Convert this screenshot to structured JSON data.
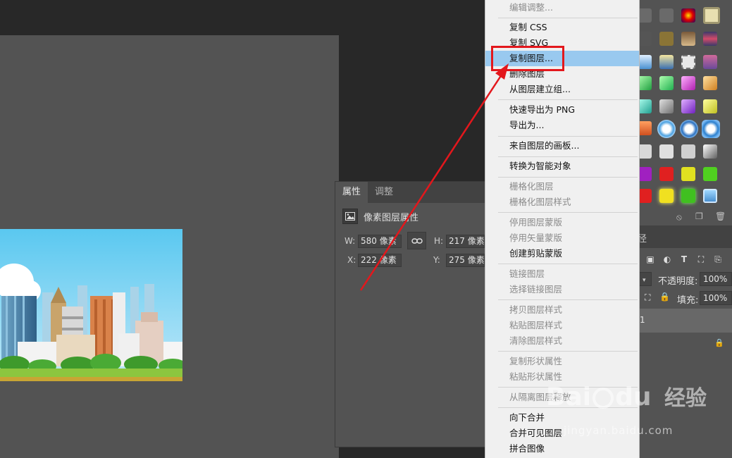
{
  "properties_panel": {
    "tabs": [
      "属性",
      "调整"
    ],
    "header": "像素图层属性",
    "w_label": "W:",
    "w_value": "580 像素",
    "h_label": "H:",
    "h_value": "217 像素",
    "x_label": "X:",
    "x_value": "222 像素",
    "y_label": "Y:",
    "y_value": "275 像素"
  },
  "layers_panel": {
    "tab_label": "径",
    "opacity_label": "不透明度:",
    "opacity_value": "100%",
    "fill_label": "填充:",
    "fill_value": "100%",
    "layer_name": "1"
  },
  "context_menu": {
    "items": [
      {
        "label": "编辑调整...",
        "disabled": true
      },
      {
        "label": "复制 CSS",
        "disabled": false
      },
      {
        "label": "复制 SVG",
        "disabled": false
      },
      {
        "label": "复制图层...",
        "disabled": false,
        "highlighted": true
      },
      {
        "label": "删除图层",
        "disabled": false
      },
      {
        "label": "从图层建立组...",
        "disabled": false
      },
      {
        "label": "快速导出为 PNG",
        "disabled": false
      },
      {
        "label": "导出为...",
        "disabled": false
      },
      {
        "label": "来自图层的画板...",
        "disabled": false
      },
      {
        "label": "转换为智能对象",
        "disabled": false
      },
      {
        "label": "栅格化图层",
        "disabled": true
      },
      {
        "label": "栅格化图层样式",
        "disabled": true
      },
      {
        "label": "停用图层蒙版",
        "disabled": true
      },
      {
        "label": "停用矢量蒙版",
        "disabled": true
      },
      {
        "label": "创建剪贴蒙版",
        "disabled": false
      },
      {
        "label": "链接图层",
        "disabled": true
      },
      {
        "label": "选择链接图层",
        "disabled": true
      },
      {
        "label": "拷贝图层样式",
        "disabled": true
      },
      {
        "label": "粘贴图层样式",
        "disabled": true
      },
      {
        "label": "清除图层样式",
        "disabled": true
      },
      {
        "label": "复制形状属性",
        "disabled": true
      },
      {
        "label": "粘贴形状属性",
        "disabled": true
      },
      {
        "label": "从隔离图层释放",
        "disabled": true
      },
      {
        "label": "向下合并",
        "disabled": false
      },
      {
        "label": "合并可见图层",
        "disabled": false
      },
      {
        "label": "拼合图像",
        "disabled": false
      }
    ]
  },
  "watermark": {
    "brand_prefix": "Bai",
    "brand_suffix": "du",
    "brand_cn": "经验",
    "url": "jingyan.baidu.com"
  },
  "colors": {
    "highlight": "#99c9ef",
    "annotation": "#e3171c",
    "panel": "#535353",
    "workspace": "#282828"
  }
}
